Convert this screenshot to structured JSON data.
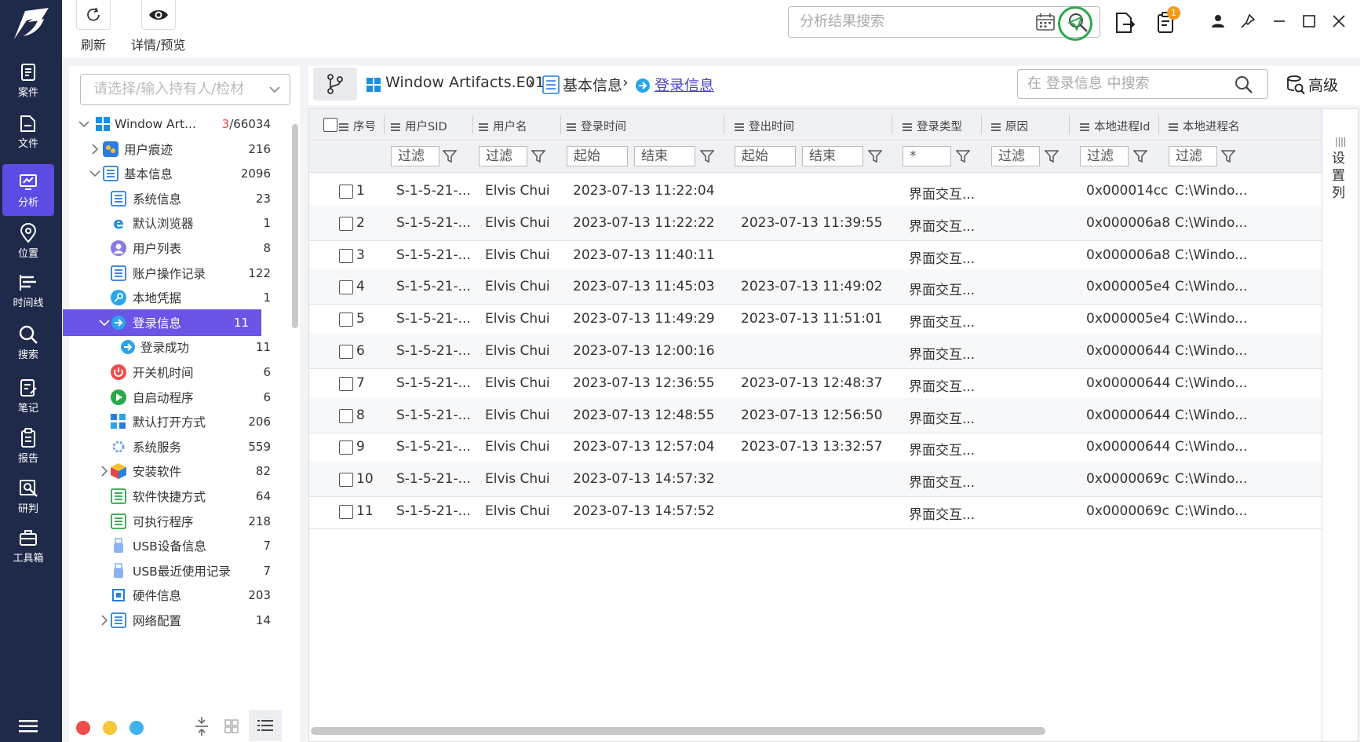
{
  "nav": {
    "items": [
      {
        "label": "案件",
        "icon": "case-icon"
      },
      {
        "label": "文件",
        "icon": "folder-icon"
      },
      {
        "label": "分析",
        "icon": "analysis-icon"
      },
      {
        "label": "位置",
        "icon": "location-icon"
      },
      {
        "label": "时间线",
        "icon": "timeline-icon"
      },
      {
        "label": "搜索",
        "icon": "search-icon"
      },
      {
        "label": "笔记",
        "icon": "note-icon"
      },
      {
        "label": "报告",
        "icon": "report-icon"
      },
      {
        "label": "研判",
        "icon": "investigate-icon"
      },
      {
        "label": "工具箱",
        "icon": "toolbox-icon"
      }
    ],
    "active_index": 2,
    "accent": "#5b4ce4",
    "background": "#1f2a4a"
  },
  "toolbar": {
    "refresh_label": "刷新",
    "detail_label": "详情/预览",
    "search_placeholder": "分析结果搜索",
    "notify_count": "1"
  },
  "tree": {
    "holder_placeholder": "请选择/输入持有人/检材",
    "items": [
      {
        "label": "Window Art...",
        "count_prefix": "3",
        "count": "/66034",
        "icon": "windows-icon"
      },
      {
        "label": "用户痕迹",
        "count": "216",
        "icon": "user-trace-icon"
      },
      {
        "label": "基本信息",
        "count": "2096",
        "icon": "list-icon"
      },
      {
        "label": "系统信息",
        "count": "23",
        "icon": "system-info-icon"
      },
      {
        "label": "默认浏览器",
        "count": "1",
        "icon": "ie-icon"
      },
      {
        "label": "用户列表",
        "count": "8",
        "icon": "user-icon"
      },
      {
        "label": "账户操作记录",
        "count": "122",
        "icon": "account-log-icon"
      },
      {
        "label": "本地凭据",
        "count": "1",
        "icon": "key-icon"
      },
      {
        "label": "登录信息",
        "count": "11",
        "icon": "login-icon"
      },
      {
        "label": "登录成功",
        "count": "11",
        "icon": "login-success-icon"
      },
      {
        "label": "开关机时间",
        "count": "6",
        "icon": "power-icon"
      },
      {
        "label": "自启动程序",
        "count": "6",
        "icon": "autostart-icon"
      },
      {
        "label": "默认打开方式",
        "count": "206",
        "icon": "default-open-icon"
      },
      {
        "label": "系统服务",
        "count": "559",
        "icon": "service-icon"
      },
      {
        "label": "安装软件",
        "count": "82",
        "icon": "package-icon"
      },
      {
        "label": "软件快捷方式",
        "count": "64",
        "icon": "shortcut-icon"
      },
      {
        "label": "可执行程序",
        "count": "218",
        "icon": "exe-icon"
      },
      {
        "label": "USB设备信息",
        "count": "7",
        "icon": "usb-icon"
      },
      {
        "label": "USB最近使用记录",
        "count": "7",
        "icon": "usb-icon"
      },
      {
        "label": "硬件信息",
        "count": "203",
        "icon": "chip-icon"
      },
      {
        "label": "网络配置",
        "count": "14",
        "icon": "network-icon"
      }
    ]
  },
  "breadcrumb": {
    "evidence": "Window Artifacts.E01",
    "category": "基本信息",
    "current": "登录信息",
    "search_placeholder": "在 登录信息 中搜索",
    "advanced_label": "高级"
  },
  "table": {
    "columns": [
      "序号",
      "用户SID",
      "用户名",
      "登录时间",
      "登出时间",
      "登录类型",
      "原因",
      "本地进程Id",
      "本地进程名"
    ],
    "filters": {
      "filter": "过滤",
      "start": "起始",
      "end": "结束",
      "star": "*"
    },
    "settings_label": "设置列",
    "rows": [
      {
        "no": "1",
        "sid": "S-1-5-21-...",
        "user": "Elvis Chui",
        "login": "2023-07-13 11:22:04",
        "logout": "",
        "type": "界面交互...",
        "pid": "0x000014cc",
        "pname": "C:\\Windo..."
      },
      {
        "no": "2",
        "sid": "S-1-5-21-...",
        "user": "Elvis Chui",
        "login": "2023-07-13 11:22:22",
        "logout": "2023-07-13 11:39:55",
        "type": "界面交互...",
        "pid": "0x000006a8",
        "pname": "C:\\Windo..."
      },
      {
        "no": "3",
        "sid": "S-1-5-21-...",
        "user": "Elvis Chui",
        "login": "2023-07-13 11:40:11",
        "logout": "",
        "type": "界面交互...",
        "pid": "0x000006a8",
        "pname": "C:\\Windo..."
      },
      {
        "no": "4",
        "sid": "S-1-5-21-...",
        "user": "Elvis Chui",
        "login": "2023-07-13 11:45:03",
        "logout": "2023-07-13 11:49:02",
        "type": "界面交互...",
        "pid": "0x000005e4",
        "pname": "C:\\Windo..."
      },
      {
        "no": "5",
        "sid": "S-1-5-21-...",
        "user": "Elvis Chui",
        "login": "2023-07-13 11:49:29",
        "logout": "2023-07-13 11:51:01",
        "type": "界面交互...",
        "pid": "0x000005e4",
        "pname": "C:\\Windo..."
      },
      {
        "no": "6",
        "sid": "S-1-5-21-...",
        "user": "Elvis Chui",
        "login": "2023-07-13 12:00:16",
        "logout": "",
        "type": "界面交互...",
        "pid": "0x00000644",
        "pname": "C:\\Windo..."
      },
      {
        "no": "7",
        "sid": "S-1-5-21-...",
        "user": "Elvis Chui",
        "login": "2023-07-13 12:36:55",
        "logout": "2023-07-13 12:48:37",
        "type": "界面交互...",
        "pid": "0x00000644",
        "pname": "C:\\Windo..."
      },
      {
        "no": "8",
        "sid": "S-1-5-21-...",
        "user": "Elvis Chui",
        "login": "2023-07-13 12:48:55",
        "logout": "2023-07-13 12:56:50",
        "type": "界面交互...",
        "pid": "0x00000644",
        "pname": "C:\\Windo..."
      },
      {
        "no": "9",
        "sid": "S-1-5-21-...",
        "user": "Elvis Chui",
        "login": "2023-07-13 12:57:04",
        "logout": "2023-07-13 13:32:57",
        "type": "界面交互...",
        "pid": "0x00000644",
        "pname": "C:\\Windo..."
      },
      {
        "no": "10",
        "sid": "S-1-5-21-...",
        "user": "Elvis Chui",
        "login": "2023-07-13 14:57:32",
        "logout": "",
        "type": "界面交互...",
        "pid": "0x0000069c",
        "pname": "C:\\Windo..."
      },
      {
        "no": "11",
        "sid": "S-1-5-21-...",
        "user": "Elvis Chui",
        "login": "2023-07-13 14:57:52",
        "logout": "",
        "type": "界面交互...",
        "pid": "0x0000069c",
        "pname": "C:\\Windo..."
      }
    ]
  },
  "colors": {
    "selection": "#6b55e6",
    "link": "#4a44c6",
    "green": "#2aa84a",
    "orange_badge": "#f39a1a",
    "dot_red": "#ee4c4c",
    "dot_yellow": "#f5c73a",
    "dot_blue": "#3fb3f0"
  }
}
